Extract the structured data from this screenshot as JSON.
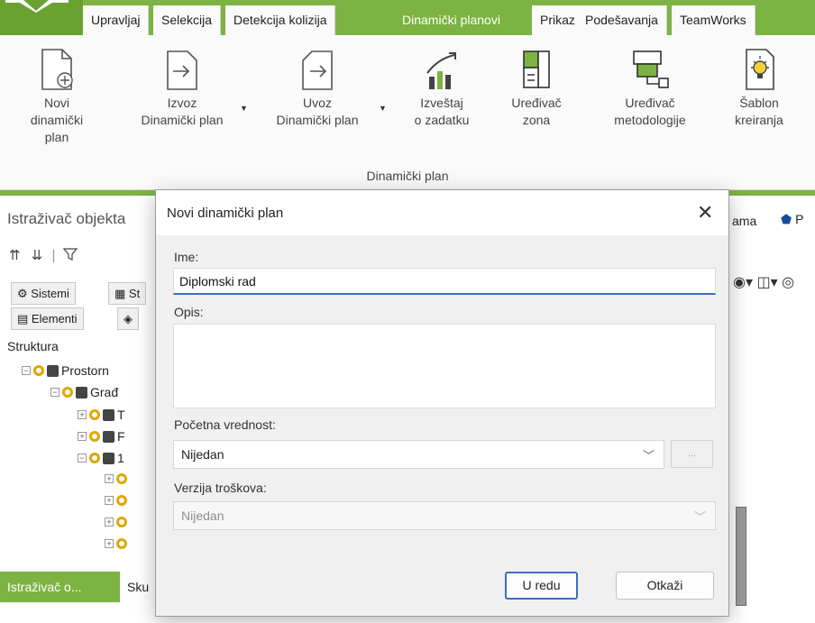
{
  "tabs": [
    {
      "label": "Upravljaj"
    },
    {
      "label": "Selekcija"
    },
    {
      "label": "Detekcija kolizija"
    },
    {
      "label": "Dinamički planovi",
      "active": true
    },
    {
      "label": "Prikaz"
    },
    {
      "label": "Podešavanja"
    },
    {
      "label": "TeamWorks"
    }
  ],
  "ribbon": {
    "buttons": [
      {
        "label": "Novi\ndinamički\nplan",
        "icon": "new-plan-icon"
      },
      {
        "label": "Izvoz\nDinamički plan",
        "icon": "export-icon",
        "dropdown": true
      },
      {
        "label": "Uvoz\nDinamički plan",
        "icon": "import-icon",
        "dropdown": true
      },
      {
        "label": "Izveštaj\no zadatku",
        "icon": "report-chart-icon"
      },
      {
        "label": "Uređivač\nzona",
        "icon": "zone-editor-icon"
      },
      {
        "label": "Uređivač\nmetodologije",
        "icon": "methodology-editor-icon"
      },
      {
        "label": "Šablon\nkreiranja",
        "icon": "template-bulb-icon"
      }
    ],
    "group_label": "Dinamički plan"
  },
  "explorer": {
    "title": "Istraživač objekta",
    "tabs": [
      "Sistemi",
      "St",
      "Elementi"
    ],
    "tree_label": "Struktura",
    "tree": [
      {
        "label": "Prostorn"
      },
      {
        "label": "Građ"
      },
      {
        "label": "T"
      },
      {
        "label": "F"
      },
      {
        "label": "1"
      }
    ],
    "bottom_tabs": [
      "Istraživač o...",
      "Sku"
    ],
    "right_tabs": [
      "ama",
      "P"
    ]
  },
  "dialog": {
    "title": "Novi dinamički plan",
    "name_label": "Ime:",
    "name_value": "Diplomski rad",
    "description_label": "Opis:",
    "initial_value_label": "Početna vrednost:",
    "initial_value": "Nijedan",
    "ellipsis_label": "...",
    "cost_version_label": "Verzija troškova:",
    "cost_version_value": "Nijedan",
    "ok_label": "U redu",
    "cancel_label": "Otkaži"
  },
  "colors": {
    "accent_green": "#7cb342",
    "focus_blue": "#3c6fbf"
  }
}
